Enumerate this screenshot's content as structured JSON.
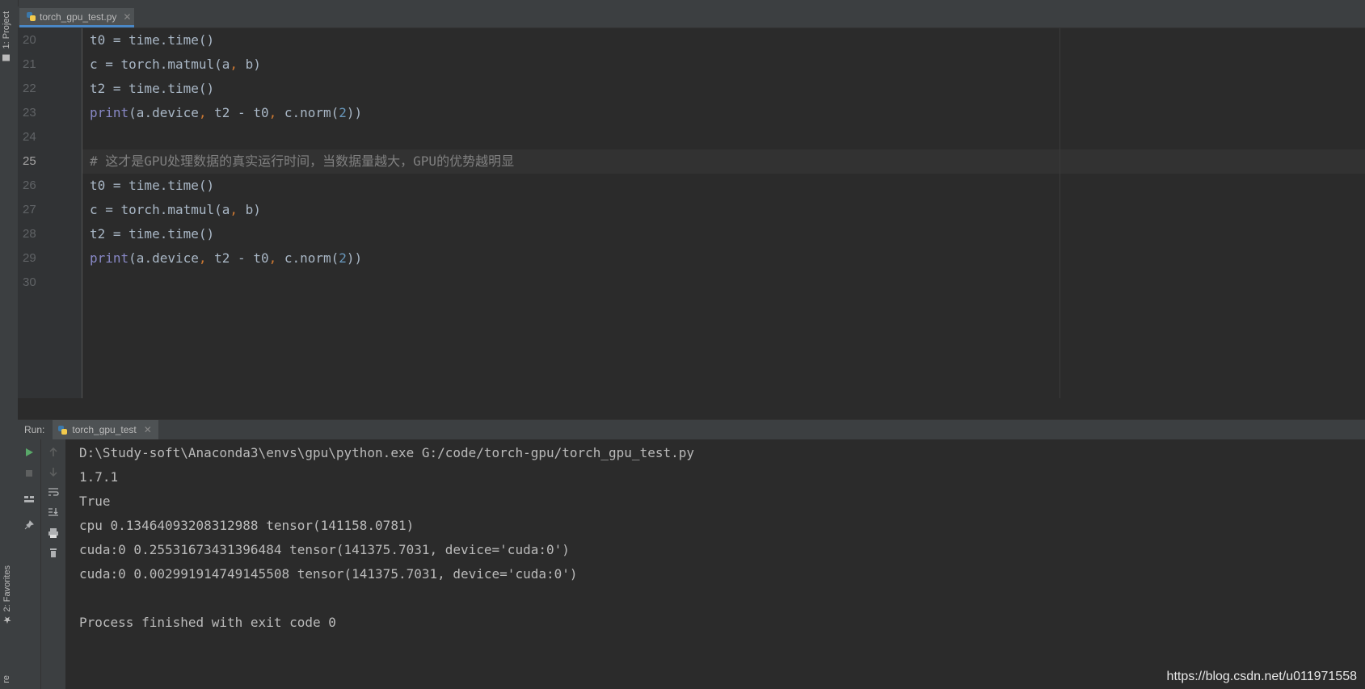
{
  "tool_strip": {
    "project_label": "1: Project",
    "favorites_label": "2: Favorites",
    "structure_label": "re"
  },
  "editor": {
    "tab_filename": "torch_gpu_test.py",
    "lines": [
      {
        "num": "20",
        "text": "t0 = time.time()"
      },
      {
        "num": "21",
        "text": "c = torch.matmul(a, b)"
      },
      {
        "num": "22",
        "text": "t2 = time.time()"
      },
      {
        "num": "23",
        "text": "print(a.device, t2 - t0, c.norm(2))"
      },
      {
        "num": "24",
        "text": ""
      },
      {
        "num": "25",
        "text": "# 这才是GPU处理数据的真实运行时间，当数据量越大，GPU的优势越明显"
      },
      {
        "num": "26",
        "text": "t0 = time.time()"
      },
      {
        "num": "27",
        "text": "c = torch.matmul(a, b)"
      },
      {
        "num": "28",
        "text": "t2 = time.time()"
      },
      {
        "num": "29",
        "text": "print(a.device, t2 - t0, c.norm(2))"
      },
      {
        "num": "30",
        "text": ""
      }
    ],
    "current_line": "25"
  },
  "run": {
    "label": "Run:",
    "tab_name": "torch_gpu_test",
    "output": [
      "D:\\Study-soft\\Anaconda3\\envs\\gpu\\python.exe G:/code/torch-gpu/torch_gpu_test.py",
      "1.7.1",
      "True",
      "cpu 0.13464093208312988 tensor(141158.0781)",
      "cuda:0 0.25531673431396484 tensor(141375.7031, device='cuda:0')",
      "cuda:0 0.002991914749145508 tensor(141375.7031, device='cuda:0')",
      "",
      "Process finished with exit code 0"
    ]
  },
  "watermark": "https://blog.csdn.net/u011971558",
  "colors": {
    "background": "#2b2b2b",
    "keyword": "#8888c6",
    "number": "#6897bb",
    "comment": "#808080",
    "text": "#a9b7c6",
    "run_icon": "#59a869"
  }
}
